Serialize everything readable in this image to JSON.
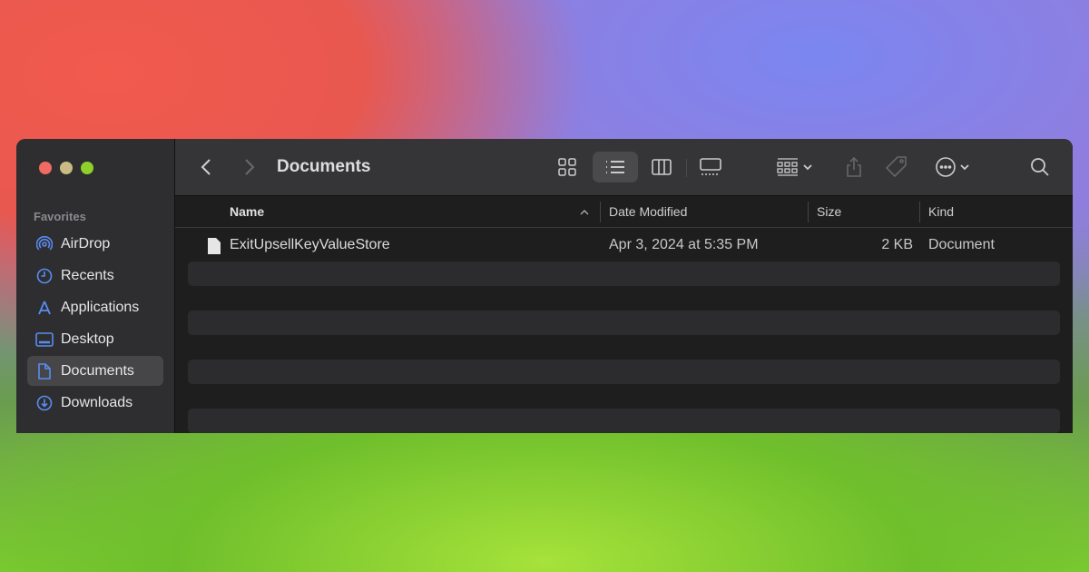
{
  "window": {
    "title": "Documents",
    "traffic_lights": {
      "close": "#f26b62",
      "minimize": "#c9c98a",
      "zoom": "#8fd12a"
    }
  },
  "sidebar": {
    "section": "Favorites",
    "items": [
      {
        "label": "AirDrop",
        "icon": "airdrop-icon"
      },
      {
        "label": "Recents",
        "icon": "clock-icon"
      },
      {
        "label": "Applications",
        "icon": "applications-icon"
      },
      {
        "label": "Desktop",
        "icon": "desktop-icon"
      },
      {
        "label": "Documents",
        "icon": "document-icon",
        "selected": true
      },
      {
        "label": "Downloads",
        "icon": "download-icon"
      }
    ]
  },
  "toolbar": {
    "view_mode": "list",
    "icons": [
      "back-icon",
      "forward-icon",
      "icon-view-icon",
      "list-view-icon",
      "column-view-icon",
      "gallery-view-icon",
      "group-icon",
      "share-icon",
      "tag-icon",
      "more-icon",
      "search-icon"
    ]
  },
  "table": {
    "columns": [
      "Name",
      "Date Modified",
      "Size",
      "Kind"
    ],
    "sort": "Name ascending",
    "rows": [
      {
        "name": "ExitUpsellKeyValueStore",
        "date": "Apr 3, 2024 at 5:35 PM",
        "size": "2 KB",
        "kind": "Document"
      }
    ]
  }
}
